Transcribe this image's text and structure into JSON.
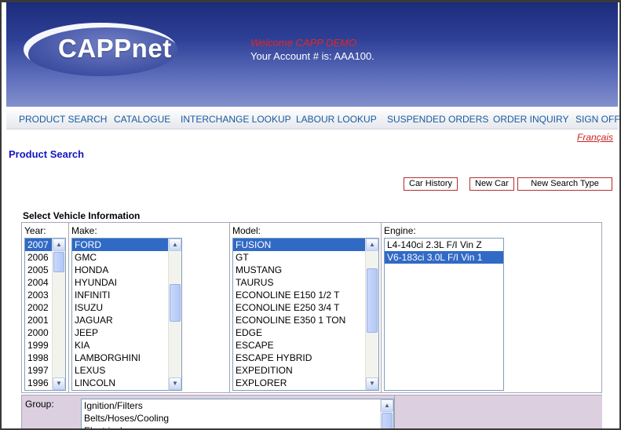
{
  "brand": {
    "logo_text": "CAPPnet"
  },
  "header": {
    "welcome": "Welcome CAPP DEMO",
    "account": "Your Account # is: AAA100."
  },
  "nav": [
    "PRODUCT SEARCH",
    "CATALOGUE",
    "INTERCHANGE LOOKUP",
    "LABOUR LOOKUP",
    "SUSPENDED ORDERS",
    "ORDER INQUIRY",
    "SIGN OFF"
  ],
  "language_link": "Français",
  "page_title": "Product Search",
  "buttons": {
    "car_history": "Car History",
    "new_car": "New Car",
    "new_search_type": "New Search Type"
  },
  "vehicle": {
    "section_title": "Select Vehicle Information",
    "year": {
      "label": "Year:",
      "options": [
        "2007",
        "2006",
        "2005",
        "2004",
        "2003",
        "2002",
        "2001",
        "2000",
        "1999",
        "1998",
        "1997",
        "1996"
      ],
      "selected": "2007"
    },
    "make": {
      "label": "Make:",
      "options": [
        "FORD",
        "GMC",
        "HONDA",
        "HYUNDAI",
        "INFINITI",
        "ISUZU",
        "JAGUAR",
        "JEEP",
        "KIA",
        "LAMBORGHINI",
        "LEXUS",
        "LINCOLN"
      ],
      "selected": "FORD"
    },
    "model": {
      "label": "Model:",
      "options": [
        "FUSION",
        "GT",
        "MUSTANG",
        "TAURUS",
        "ECONOLINE E150 1/2 T",
        "ECONOLINE E250 3/4 T",
        "ECONOLINE E350 1 TON",
        "EDGE",
        "ESCAPE",
        "ESCAPE HYBRID",
        "EXPEDITION",
        "EXPLORER"
      ],
      "selected": "FUSION"
    },
    "engine": {
      "label": "Engine:",
      "options": [
        "L4-140ci 2.3L F/I Vin Z",
        "V6-183ci 3.0L F/I Vin 1"
      ],
      "selected": "V6-183ci 3.0L F/I Vin 1"
    }
  },
  "group": {
    "label": "Group:",
    "options": [
      "Ignition/Filters",
      "Belts/Hoses/Cooling",
      "Electrical"
    ]
  },
  "colors": {
    "nav_text": "#1a5aa0",
    "selection": "#316ac5",
    "welcome": "#e52525"
  }
}
